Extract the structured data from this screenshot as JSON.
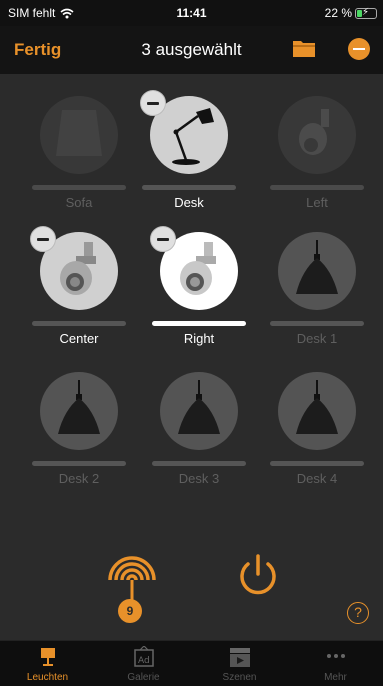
{
  "status": {
    "carrier": "SIM fehlt",
    "time": "11:41",
    "battery": "22 %"
  },
  "nav": {
    "done_label": "Fertig",
    "title": "3 ausgewählt"
  },
  "lamps": [
    {
      "name": "Sofa",
      "state": "unselected"
    },
    {
      "name": "Desk",
      "state": "selected"
    },
    {
      "name": "Left",
      "state": "unselected"
    },
    {
      "name": "Center",
      "state": "selected"
    },
    {
      "name": "Right",
      "state": "selected-on"
    },
    {
      "name": "Desk 1",
      "state": "unselected"
    },
    {
      "name": "Desk 2",
      "state": "unselected"
    },
    {
      "name": "Desk 3",
      "state": "unselected"
    },
    {
      "name": "Desk 4",
      "state": "unselected"
    }
  ],
  "actions": {
    "bridge_count": "9",
    "help": "?"
  },
  "tabs": [
    {
      "label": "Leuchten",
      "icon": "lamp-icon",
      "active": true
    },
    {
      "label": "Galerie",
      "icon": "gallery-icon",
      "active": false
    },
    {
      "label": "Szenen",
      "icon": "scenes-icon",
      "active": false
    },
    {
      "label": "Mehr",
      "icon": "more-icon",
      "active": false
    }
  ],
  "colors": {
    "accent": "#e8912a",
    "background": "#2b2b2b",
    "bar": "#141414"
  }
}
